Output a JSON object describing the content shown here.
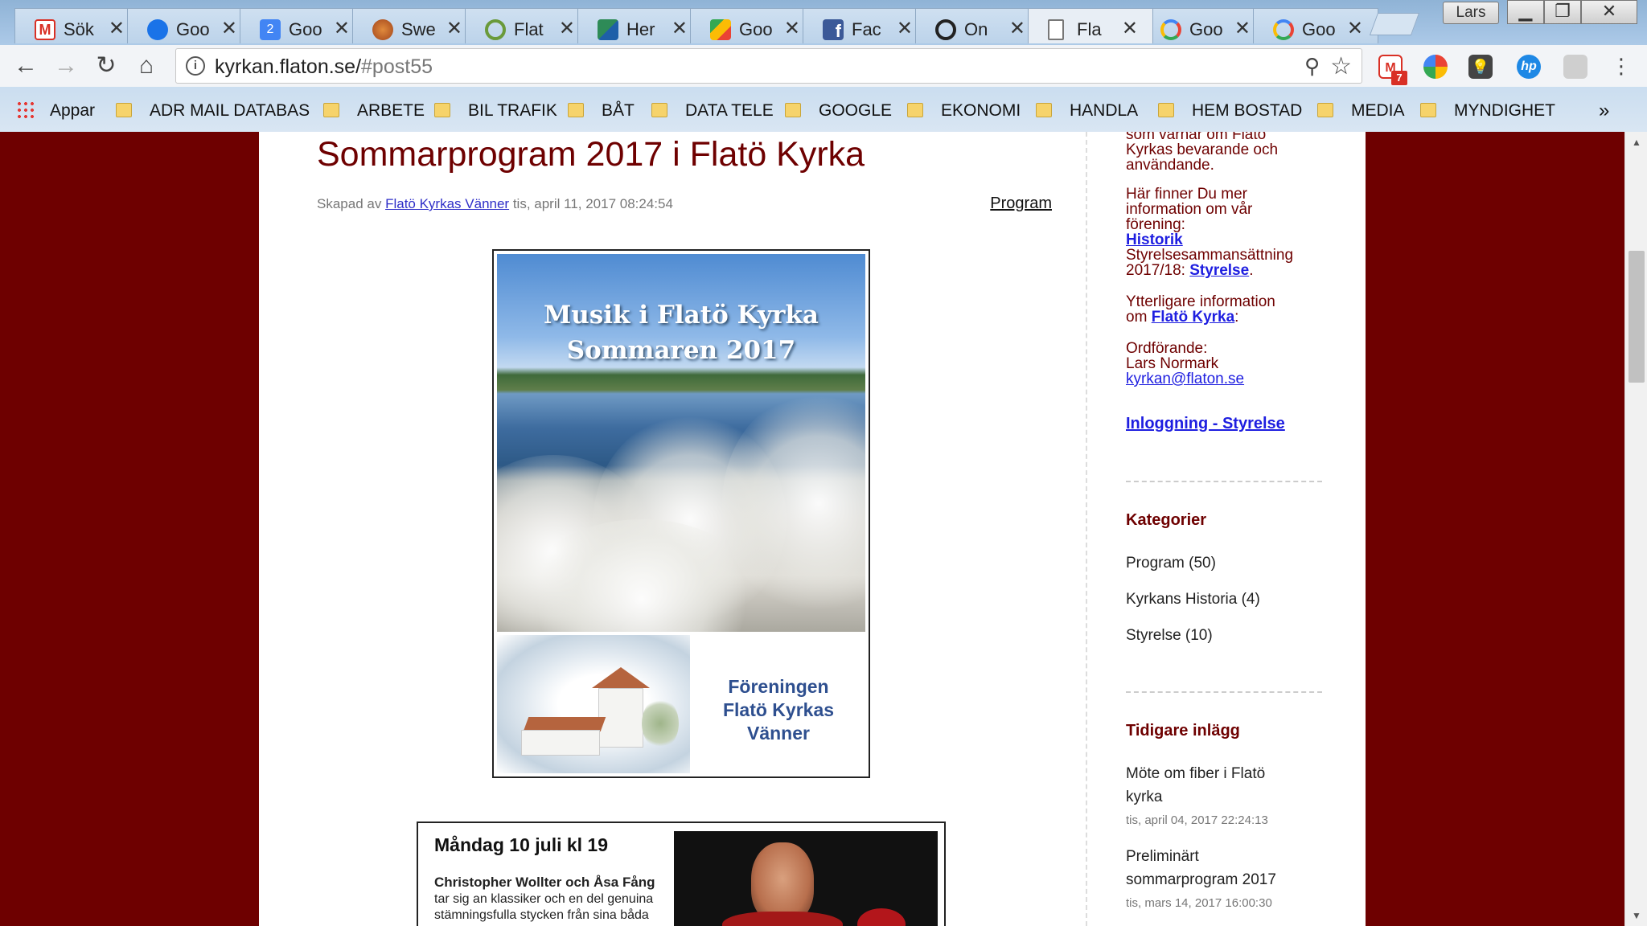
{
  "browser": {
    "tabs": [
      {
        "title": "Sök",
        "favicon": "gmail-icon",
        "color": "#d93025"
      },
      {
        "title": "Goo",
        "favicon": "google-contacts-icon",
        "color": "#1a73e8"
      },
      {
        "title": "Goo",
        "favicon": "google-calendar-icon",
        "color": "#4285f4"
      },
      {
        "title": "Swe",
        "favicon": "orange-ball-icon",
        "color": "#c8642a"
      },
      {
        "title": "Flat",
        "favicon": "ring-icon",
        "color": "#6a9a3a"
      },
      {
        "title": "Her",
        "favicon": "green-triangle-icon",
        "color": "#2e8b57"
      },
      {
        "title": "Goo",
        "favicon": "google-maps-icon",
        "color": "#34a853"
      },
      {
        "title": "Fac",
        "favicon": "facebook-icon",
        "color": "#3b5998"
      },
      {
        "title": "On",
        "favicon": "ring-icon",
        "color": "#222222"
      },
      {
        "title": "Fla",
        "favicon": "document-icon",
        "color": "#777777"
      },
      {
        "title": "Goo",
        "favicon": "google-g-icon",
        "color": "#4285f4"
      },
      {
        "title": "Goo",
        "favicon": "google-g-icon",
        "color": "#4285f4"
      }
    ],
    "active_tab_index": 9,
    "profile_label": "Lars",
    "url_host": "kyrkan.flaton.se/",
    "url_path": "#post55",
    "gmail_badge": "7",
    "bookmarks": [
      "Appar",
      "ADR MAIL DATABAS",
      "ARBETE",
      "BIL TRAFIK",
      "BÅT",
      "DATA TELE",
      "GOOGLE",
      "EKONOMI",
      "HANDLA",
      "HEM BOSTAD",
      "MEDIA",
      "MYNDIGHET"
    ],
    "bookmarks_more": "»"
  },
  "post": {
    "title": "Sommarprogram 2017 i Flatö Kyrka",
    "meta_prefix": "Skapad av",
    "author": "Flatö Kyrkas Vänner",
    "date": "tis, april 11, 2017 08:24:54",
    "category": "Program",
    "poster": {
      "title_line1": "Musik i Flatö Kyrka",
      "title_line2": "Sommaren 2017",
      "association_line1": "Föreningen",
      "association_line2": "Flatö Kyrkas",
      "association_line3": "Vänner"
    },
    "event": {
      "date": "Måndag 10 juli kl 19",
      "performers": "Christopher Wollter och Åsa Fång",
      "desc_line1": "tar sig an klassiker och en del genuina",
      "desc_line2": "stämningsfulla stycken från sina båda"
    }
  },
  "sidebar": {
    "intro_line1": "som värnar om Flatö",
    "intro_line2": "Kyrkas bevarande och",
    "intro_line3": "användande.",
    "info_line1": "Här finner Du mer",
    "info_line2": "information om vår",
    "info_line3": "förening:",
    "historik_link": "Historik",
    "board_line1": "Styrelsesammansättning",
    "board_line2_prefix": "2017/18:",
    "board_link": "Styrelse",
    "more_line1": "Ytterligare information",
    "more_prefix": "om",
    "more_link": "Flatö Kyrka",
    "chair_label": "Ordförande:",
    "chair_name": "Lars Normark",
    "chair_email": "kyrkan@flaton.se",
    "login_link": "Inloggning - Styrelse",
    "categories_heading": "Kategorier",
    "categories": [
      "Program (50)",
      "Kyrkans Historia (4)",
      "Styrelse (10)"
    ],
    "previous_heading": "Tidigare inlägg",
    "previous_posts": [
      {
        "title_line1": "Möte om fiber i Flatö",
        "title_line2": "kyrka",
        "date": "tis, april 04, 2017 22:24:13"
      },
      {
        "title_line1": "Preliminärt",
        "title_line2": "sommarprogram 2017",
        "date": "tis, mars 14, 2017 16:00:30"
      }
    ]
  }
}
